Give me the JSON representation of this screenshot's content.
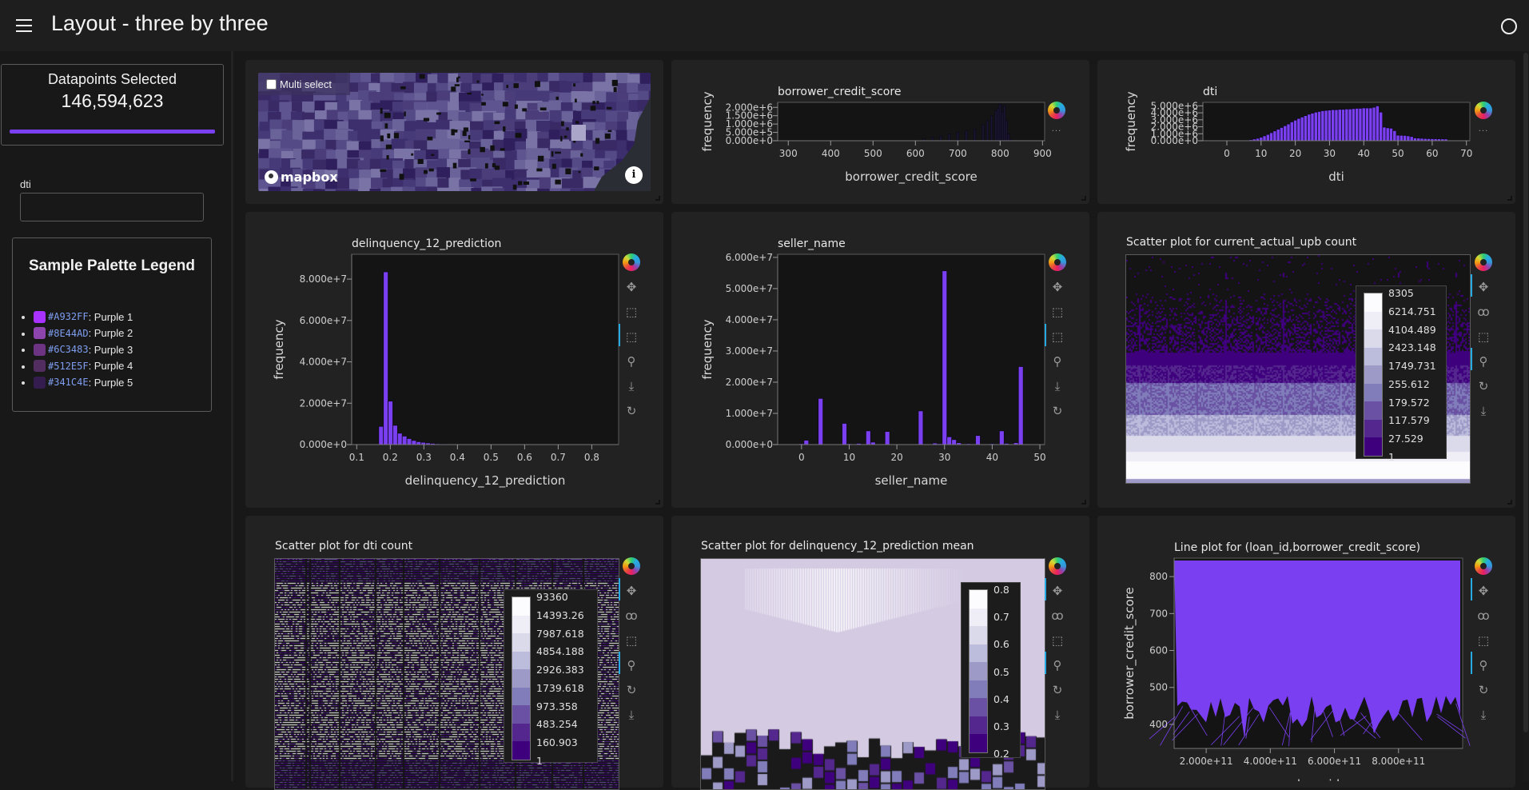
{
  "header": {
    "title": "Layout - three by three",
    "menu_icon": "hamburger-menu-icon",
    "status_icon": "status-circle-icon"
  },
  "sidebar": {
    "datapoints": {
      "label": "Datapoints Selected",
      "value": "146,594,623",
      "progress_fraction": 1.0,
      "bar_color": "#7B3FF2"
    },
    "dti_filter": {
      "label": "dti",
      "value": "",
      "placeholder": ""
    },
    "legend": {
      "title": "Sample Palette Legend",
      "items": [
        {
          "hex": "#A932FF",
          "name": ": Purple 1",
          "color": "#A932FF"
        },
        {
          "hex": "#8E44AD",
          "name": ": Purple 2",
          "color": "#8E44AD"
        },
        {
          "hex": "#6C3483",
          "name": ": Purple 3",
          "color": "#6C3483"
        },
        {
          "hex": "#512E5F",
          "name": ": Purple 4",
          "color": "#512E5F"
        },
        {
          "hex": "#341C4E",
          "name": ": Purple 5",
          "color": "#341C4E"
        }
      ]
    }
  },
  "map": {
    "multi_select_label": "Multi select",
    "multi_select_checked": false,
    "attribution": "mapbox",
    "info_button": "i"
  },
  "toolbar_labels": {
    "logo": "bokeh-logo",
    "pan": "✥",
    "box_zoom": "⬚",
    "xbox_select": "⬚",
    "wheel_zoom": "⚲",
    "save": "⤓",
    "reset": "↻",
    "lasso": "ꝏ",
    "box_select": "⬚",
    "more": "···"
  },
  "chart_data": [
    {
      "id": "borrower_credit_score",
      "type": "bar",
      "title": "borrower_credit_score",
      "xlabel": "borrower_credit_score",
      "ylabel": "frequency",
      "xlim": [
        275,
        905
      ],
      "ylim": [
        0,
        2300000
      ],
      "xticks": [
        "300",
        "400",
        "500",
        "600",
        "700",
        "800",
        "900"
      ],
      "xtick_values": [
        300,
        400,
        500,
        600,
        700,
        800,
        900
      ],
      "yticks": [
        "0.000e+0",
        "5.000e+5",
        "1.000e+6",
        "1.500e+6",
        "2.000e+6"
      ],
      "ytick_values": [
        0,
        500000,
        1000000,
        1500000,
        2000000
      ],
      "bar_color": "#1A1530",
      "x": [
        600,
        620,
        640,
        660,
        680,
        700,
        720,
        740,
        760,
        770,
        780,
        790,
        795,
        800,
        805,
        810,
        815,
        820,
        825
      ],
      "values": [
        20000,
        120000,
        200000,
        280000,
        400000,
        520000,
        600000,
        700000,
        950000,
        1200000,
        1500000,
        1800000,
        1950000,
        2200000,
        1700000,
        2100000,
        1200000,
        400000,
        80000
      ]
    },
    {
      "id": "dti",
      "type": "bar",
      "title": "dti",
      "xlabel": "dti",
      "ylabel": "frequency",
      "xlim": [
        -7,
        71
      ],
      "ylim": [
        0,
        5500000
      ],
      "xticks": [
        "0",
        "10",
        "20",
        "30",
        "40",
        "50",
        "60",
        "70"
      ],
      "xtick_values": [
        0,
        10,
        20,
        30,
        40,
        50,
        60,
        70
      ],
      "yticks": [
        "0.000e+0",
        "1.000e+6",
        "2.000e+6",
        "3.000e+6",
        "4.000e+6",
        "5.000e+6"
      ],
      "ytick_values": [
        0,
        1000000,
        2000000,
        3000000,
        4000000,
        5000000
      ],
      "bar_color": "#7B3FF2",
      "x": [
        6,
        7,
        8,
        9,
        10,
        11,
        12,
        13,
        14,
        15,
        16,
        17,
        18,
        19,
        20,
        21,
        22,
        23,
        24,
        25,
        26,
        27,
        28,
        29,
        30,
        31,
        32,
        33,
        34,
        35,
        36,
        37,
        38,
        39,
        40,
        41,
        42,
        43,
        44,
        45,
        46,
        47,
        48,
        49,
        50,
        51,
        52,
        53,
        54,
        55,
        56,
        57,
        58,
        59,
        60,
        61,
        62,
        63,
        64
      ],
      "values": [
        50000,
        150000,
        250000,
        350000,
        500000,
        700000,
        900000,
        1150000,
        1400000,
        1650000,
        1900000,
        2150000,
        2400000,
        2700000,
        2950000,
        3200000,
        3400000,
        3600000,
        3800000,
        3950000,
        4100000,
        4200000,
        4300000,
        4350000,
        4400000,
        4450000,
        4450000,
        4500000,
        4500000,
        4550000,
        4550000,
        4600000,
        4650000,
        4650000,
        4700000,
        4700000,
        4700000,
        4800000,
        5000000,
        4100000,
        1950000,
        1850000,
        1800000,
        1450000,
        800000,
        780000,
        760000,
        700000,
        600000,
        400000,
        380000,
        350000,
        320000,
        300000,
        290000,
        280000,
        270000,
        260000,
        250000
      ]
    },
    {
      "id": "delinquency_12_prediction",
      "type": "bar",
      "title": "delinquency_12_prediction",
      "xlabel": "delinquency_12_prediction",
      "ylabel": "frequency",
      "xlim": [
        0.085,
        0.88
      ],
      "ylim": [
        0,
        92000000
      ],
      "xticks": [
        "0.1",
        "0.2",
        "0.3",
        "0.4",
        "0.5",
        "0.6",
        "0.7",
        "0.8"
      ],
      "xtick_values": [
        0.1,
        0.2,
        0.3,
        0.4,
        0.5,
        0.6,
        0.7,
        0.8
      ],
      "yticks": [
        "0.000e+0",
        "2.000e+7",
        "4.000e+7",
        "6.000e+7",
        "8.000e+7"
      ],
      "ytick_values": [
        0,
        20000000,
        40000000,
        60000000,
        80000000
      ],
      "bar_color": "#7B3FF2",
      "x": [
        0.1725,
        0.1865,
        0.2005,
        0.2145,
        0.2285,
        0.2425,
        0.2565,
        0.2705,
        0.2845,
        0.2985,
        0.3125,
        0.3265,
        0.3405,
        0.3545,
        0.3685
      ],
      "values": [
        8800000,
        83500000,
        21000000,
        9300000,
        5500000,
        4100000,
        2900000,
        2000000,
        1400000,
        1100000,
        800000,
        600000,
        400000,
        250000,
        150000
      ]
    },
    {
      "id": "seller_name",
      "type": "bar",
      "title": "seller_name",
      "xlabel": "seller_name",
      "ylabel": "frequency",
      "xlim": [
        -5,
        51
      ],
      "ylim": [
        0,
        61000000
      ],
      "xticks": [
        "0",
        "10",
        "20",
        "30",
        "40",
        "50"
      ],
      "xtick_values": [
        0,
        10,
        20,
        30,
        40,
        50
      ],
      "yticks": [
        "0.000e+0",
        "1.000e+7",
        "2.000e+7",
        "3.000e+7",
        "4.000e+7",
        "5.000e+7",
        "6.000e+7"
      ],
      "ytick_values": [
        0,
        10000000,
        20000000,
        30000000,
        40000000,
        50000000,
        60000000
      ],
      "bar_color": "#7B3FF2",
      "x": [
        0,
        1,
        4,
        9,
        10,
        12,
        14,
        15,
        18,
        25,
        28,
        29,
        30,
        31,
        32,
        33,
        35,
        37,
        40,
        42,
        43,
        45,
        46
      ],
      "values": [
        300000,
        1400000,
        14800000,
        6800000,
        300000,
        400000,
        4400000,
        800000,
        4200000,
        10800000,
        500000,
        300000,
        55700000,
        2500000,
        1600000,
        600000,
        300000,
        2900000,
        300000,
        4400000,
        400000,
        600000,
        25000000
      ]
    },
    {
      "id": "current_actual_upb_count",
      "type": "heatmap",
      "title": "Scatter plot for current_actual_upb count",
      "colorbar_ticks": [
        "8305",
        "6214.751",
        "4104.489",
        "2423.148",
        "1749.731",
        "255.612",
        "179.572",
        "117.579",
        "27.529",
        "1"
      ],
      "colorbar_colors": [
        "#FCFBFD",
        "#EFEDF5",
        "#DADAEB",
        "#BCBDDC",
        "#9E9AC8",
        "#807DBA",
        "#6A51A3",
        "#54278F",
        "#3F007D"
      ],
      "legend_position": "right"
    },
    {
      "id": "dti_count",
      "type": "heatmap",
      "title": "Scatter plot for dti count",
      "colorbar_ticks": [
        "93360",
        "14393.26",
        "7987.618",
        "4854.188",
        "2926.383",
        "1739.618",
        "973.358",
        "483.254",
        "160.903",
        "1"
      ],
      "colorbar_colors": [
        "#FCFBFD",
        "#EFEDF5",
        "#DADAEB",
        "#BCBDDC",
        "#9E9AC8",
        "#807DBA",
        "#6A51A3",
        "#54278F",
        "#3F007D"
      ],
      "legend_position": "right"
    },
    {
      "id": "delinquency_12_prediction_mean",
      "type": "heatmap",
      "title": "Scatter plot for delinquency_12_prediction mean",
      "colorbar_ticks": [
        "0.8",
        "0.7",
        "0.6",
        "0.5",
        "0.4",
        "0.3",
        "0.2"
      ],
      "colorbar_colors": [
        "#FCFBFD",
        "#EFEDF5",
        "#DADAEB",
        "#BCBDDC",
        "#9E9AC8",
        "#807DBA",
        "#6A51A3",
        "#54278F",
        "#3F007D"
      ],
      "legend_position": "right"
    },
    {
      "id": "loan_id_credit_score_line",
      "type": "line",
      "title": "Line plot for (loan_id,borrower_credit_score)",
      "xlabel": "loan_id",
      "ylabel": "borrower_credit_score",
      "xlim": [
        100000000000,
        1000000000000
      ],
      "ylim": [
        335,
        850
      ],
      "xticks": [
        "2.000e+11",
        "4.000e+11",
        "6.000e+11",
        "8.000e+11"
      ],
      "xtick_values": [
        200000000000,
        400000000000,
        600000000000,
        800000000000
      ],
      "yticks": [
        "400",
        "500",
        "600",
        "700",
        "800"
      ],
      "ytick_values": [
        400,
        500,
        600,
        700,
        800
      ],
      "line_color": "#7B3FF2"
    }
  ]
}
